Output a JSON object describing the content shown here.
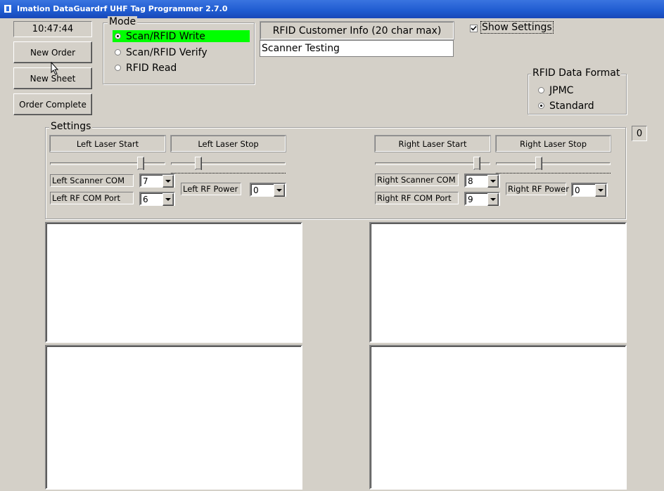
{
  "window": {
    "title": "Imation DataGuardrf UHF Tag Programmer 2.7.0"
  },
  "clock": "10:47:44",
  "buttons": {
    "new_order": "New Order",
    "new_sheet": "New Sheet",
    "order_complete": "Order Complete"
  },
  "mode": {
    "legend": "Mode",
    "options": [
      {
        "label": "Scan/RFID Write",
        "selected": true
      },
      {
        "label": "Scan/RFID Verify",
        "selected": false
      },
      {
        "label": "RFID Read",
        "selected": false
      }
    ],
    "highlight_color": "#00ff00"
  },
  "customer_info": {
    "header": "RFID Customer Info (20 char max)",
    "value": "Scanner Testing"
  },
  "show_settings": {
    "label": "Show Settings",
    "checked": true
  },
  "data_format": {
    "legend": "RFID Data Format",
    "options": [
      {
        "label": "JPMC",
        "selected": false
      },
      {
        "label": "Standard",
        "selected": true
      }
    ]
  },
  "counter": "0",
  "settings": {
    "legend": "Settings",
    "left": {
      "laser_start_label": "Left Laser Start",
      "laser_stop_label": "Left Laser Stop",
      "scanner_com_label": "Left Scanner COM",
      "scanner_com_value": "7",
      "rf_com_label": "Left RF COM Port",
      "rf_com_value": "6",
      "rf_power_label": "Left RF Power",
      "rf_power_value": "0"
    },
    "right": {
      "laser_start_label": "Right Laser Start",
      "laser_stop_label": "Right Laser Stop",
      "scanner_com_label": "Right Scanner COM",
      "scanner_com_value": "8",
      "rf_com_label": "Right RF COM Port",
      "rf_com_value": "9",
      "rf_power_label": "Right RF Power",
      "rf_power_value": "0"
    }
  }
}
